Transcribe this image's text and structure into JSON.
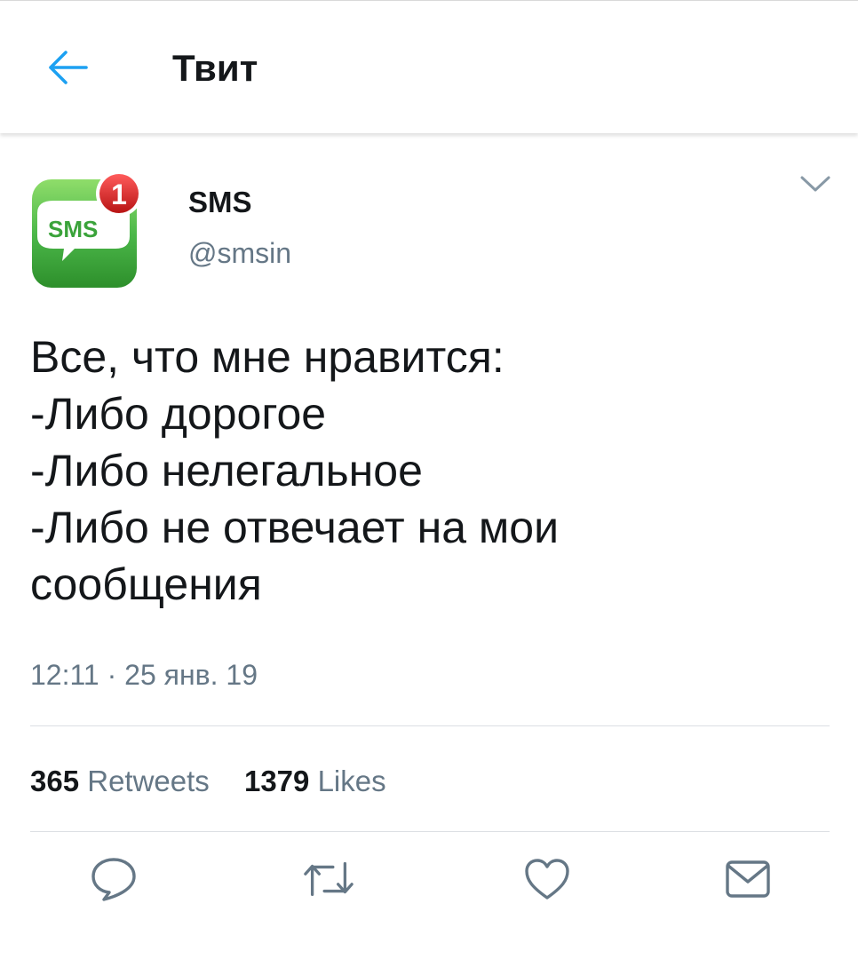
{
  "header": {
    "title": "Твит",
    "back_icon": "arrow-left-icon",
    "back_color": "#1da1f2"
  },
  "author": {
    "name": "SMS",
    "handle": "@smsin",
    "avatar": {
      "icon": "sms-app-icon",
      "label": "SMS",
      "badge_count": "1",
      "colors": {
        "green": "#4cb84a",
        "badge": "#d32222"
      }
    }
  },
  "tweet": {
    "lines": [
      "Все, что мне нравится:",
      "-Либо дорогое",
      "-Либо нелегальное",
      "-Либо не отвечает на мои",
      "сообщения"
    ],
    "time": "12:11",
    "separator": "·",
    "date": "25 янв. 19"
  },
  "stats": {
    "retweets_count": "365",
    "retweets_label": "Retweets",
    "likes_count": "1379",
    "likes_label": "Likes"
  },
  "actions": [
    {
      "icon": "reply-icon"
    },
    {
      "icon": "retweet-icon"
    },
    {
      "icon": "like-icon"
    },
    {
      "icon": "share-icon"
    }
  ],
  "colors": {
    "text": "#14171a",
    "secondary": "#657786",
    "icon_gray": "#657786",
    "divider": "#dcdfe3"
  }
}
